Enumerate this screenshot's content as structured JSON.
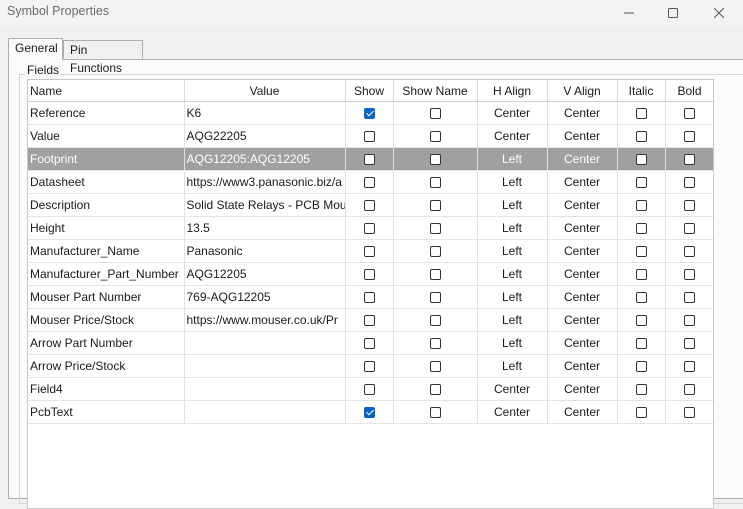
{
  "window": {
    "title": "Symbol Properties"
  },
  "tabs": [
    {
      "label": "General"
    },
    {
      "label": "Pin Functions"
    }
  ],
  "fields_group": {
    "label": "Fields"
  },
  "columns": [
    "Name",
    "Value",
    "Show",
    "Show Name",
    "H Align",
    "V Align",
    "Italic",
    "Bold"
  ],
  "rows": [
    {
      "name": "Reference",
      "value": "K6",
      "show": true,
      "show_name": false,
      "h_align": "Center",
      "v_align": "Center",
      "italic": false,
      "bold": false
    },
    {
      "name": "Value",
      "value": "AQG22205",
      "show": false,
      "show_name": false,
      "h_align": "Center",
      "v_align": "Center",
      "italic": false,
      "bold": false
    },
    {
      "name": "Footprint",
      "value": "AQG12205:AQG12205",
      "show": false,
      "show_name": false,
      "h_align": "Left",
      "v_align": "Center",
      "italic": false,
      "bold": false,
      "selected": true
    },
    {
      "name": "Datasheet",
      "value": "https://www3.panasonic.biz/a",
      "show": false,
      "show_name": false,
      "h_align": "Left",
      "v_align": "Center",
      "italic": false,
      "bold": false
    },
    {
      "name": "Description",
      "value": "Solid State Relays - PCB Mour",
      "show": false,
      "show_name": false,
      "h_align": "Left",
      "v_align": "Center",
      "italic": false,
      "bold": false
    },
    {
      "name": "Height",
      "value": "13.5",
      "show": false,
      "show_name": false,
      "h_align": "Left",
      "v_align": "Center",
      "italic": false,
      "bold": false
    },
    {
      "name": "Manufacturer_Name",
      "value": "Panasonic",
      "show": false,
      "show_name": false,
      "h_align": "Left",
      "v_align": "Center",
      "italic": false,
      "bold": false
    },
    {
      "name": "Manufacturer_Part_Number",
      "value": "AQG12205",
      "show": false,
      "show_name": false,
      "h_align": "Left",
      "v_align": "Center",
      "italic": false,
      "bold": false
    },
    {
      "name": "Mouser Part Number",
      "value": "769-AQG12205",
      "show": false,
      "show_name": false,
      "h_align": "Left",
      "v_align": "Center",
      "italic": false,
      "bold": false
    },
    {
      "name": "Mouser Price/Stock",
      "value": "https://www.mouser.co.uk/Pr",
      "show": false,
      "show_name": false,
      "h_align": "Left",
      "v_align": "Center",
      "italic": false,
      "bold": false
    },
    {
      "name": "Arrow Part Number",
      "value": "",
      "show": false,
      "show_name": false,
      "h_align": "Left",
      "v_align": "Center",
      "italic": false,
      "bold": false
    },
    {
      "name": "Arrow Price/Stock",
      "value": "",
      "show": false,
      "show_name": false,
      "h_align": "Left",
      "v_align": "Center",
      "italic": false,
      "bold": false
    },
    {
      "name": "Field4",
      "value": "",
      "show": false,
      "show_name": false,
      "h_align": "Center",
      "v_align": "Center",
      "italic": false,
      "bold": false
    },
    {
      "name": "PcbText",
      "value": "",
      "show": true,
      "show_name": false,
      "h_align": "Center",
      "v_align": "Center",
      "italic": false,
      "bold": false
    }
  ],
  "colors": {
    "accent": "#0a64c8",
    "selected_row": "#a0a0a0"
  },
  "icons": {
    "minimize": "minimize-icon",
    "maximize": "maximize-icon",
    "close": "close-icon"
  }
}
